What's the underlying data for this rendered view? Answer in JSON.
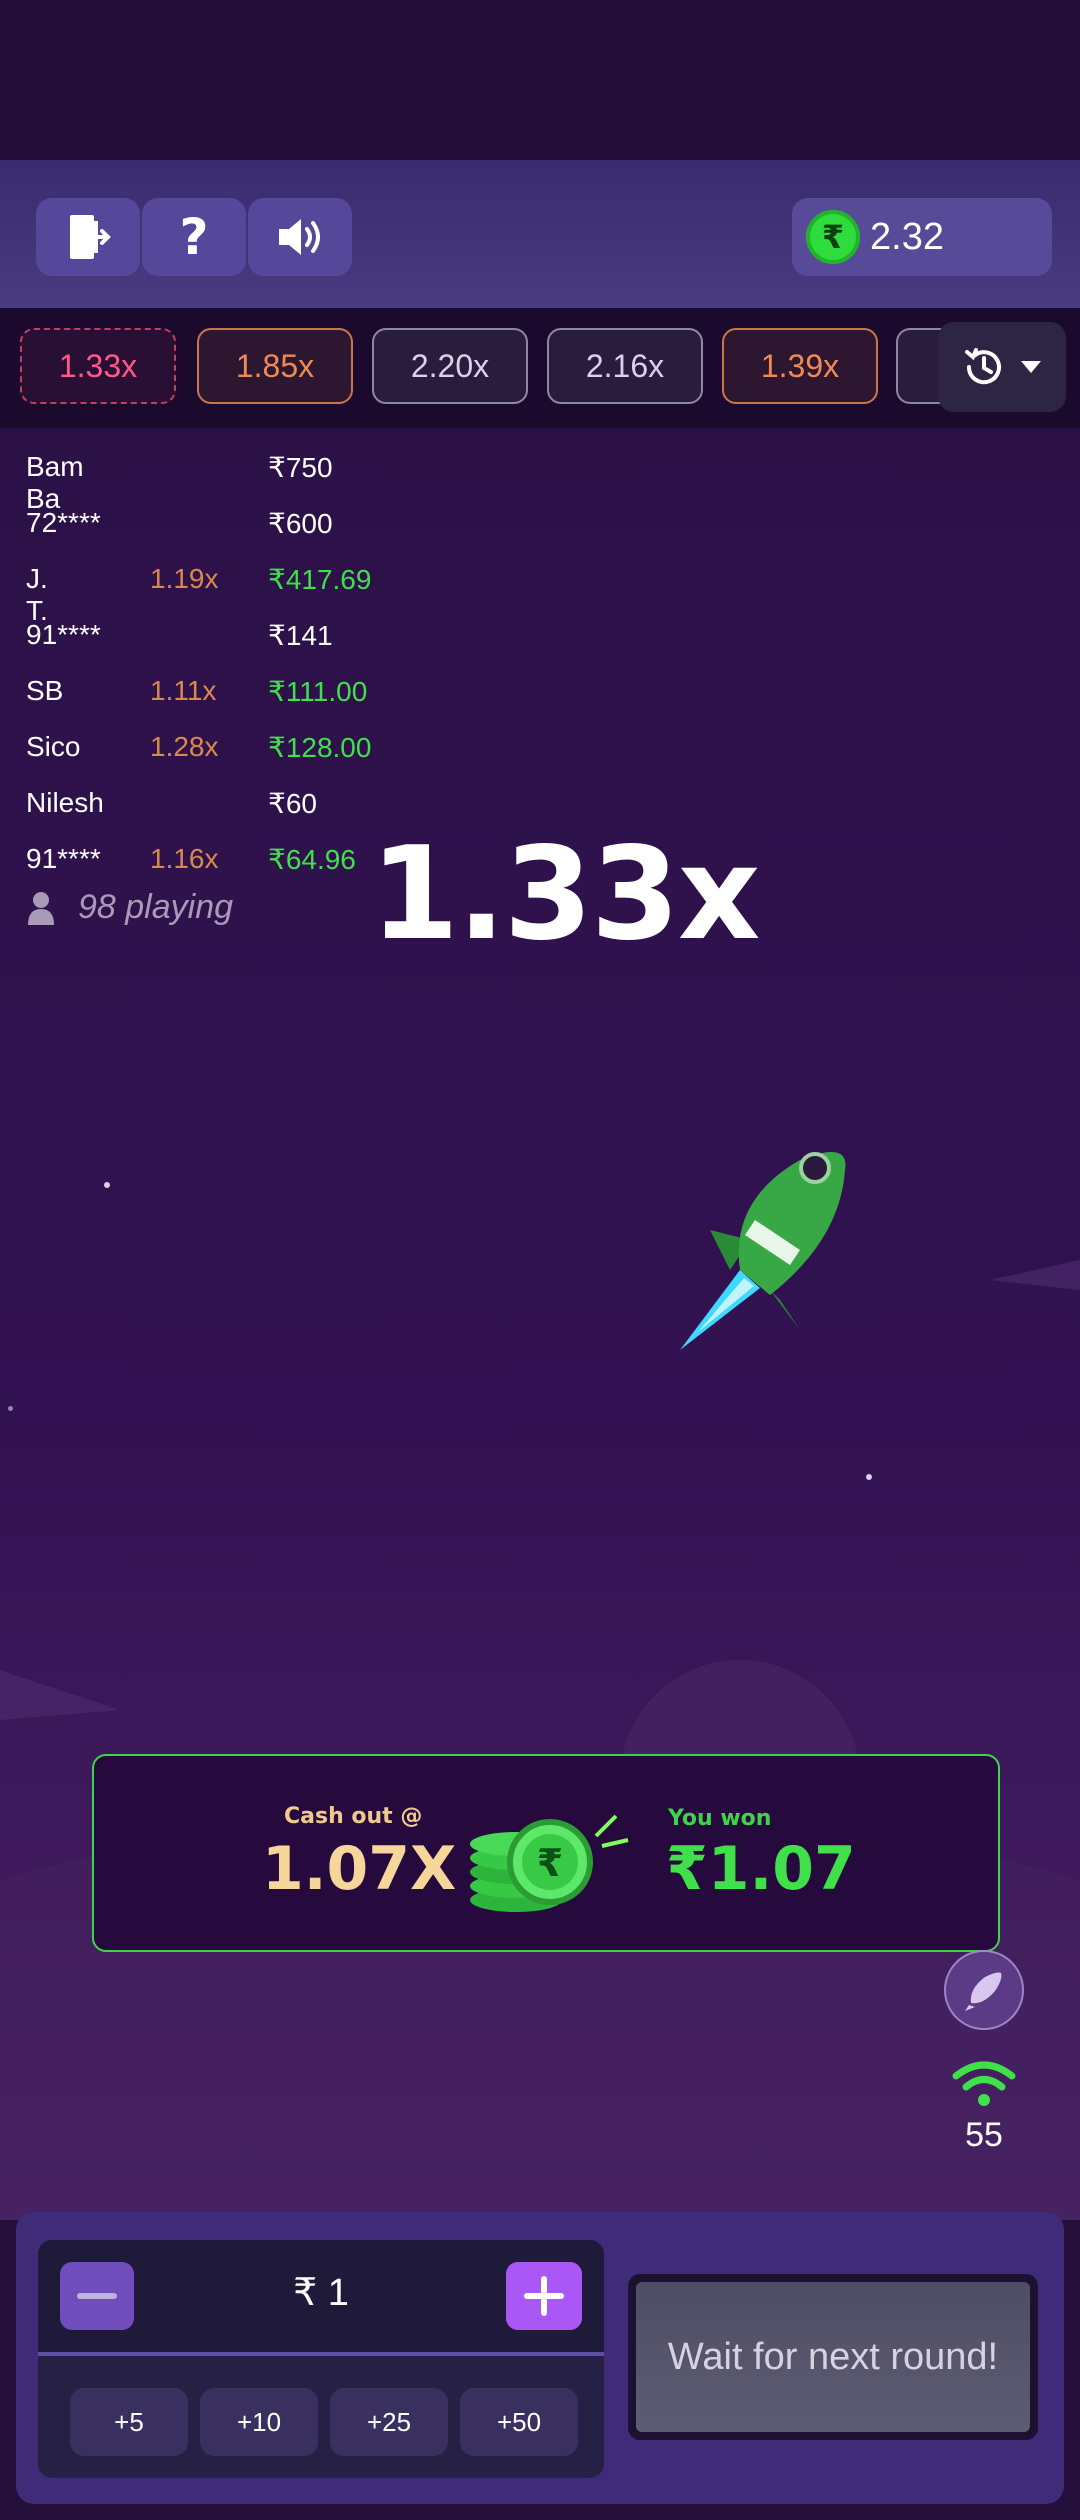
{
  "toolbar": {
    "exit_icon": "exit-door-icon",
    "help_icon": "question-icon",
    "sound_icon": "speaker-icon",
    "balance_currency": "₹",
    "balance": "2.32"
  },
  "history": {
    "items": [
      "1.33x",
      "1.85x",
      "2.20x",
      "2.16x",
      "1.39x"
    ],
    "item_colors": [
      "pink",
      "orange",
      "gray",
      "gray",
      "orange"
    ],
    "toggle_icon": "history-clock-icon"
  },
  "players": [
    {
      "name": "Bam Ba",
      "mult": "",
      "amount": "₹750",
      "won": false
    },
    {
      "name": "72****",
      "mult": "",
      "amount": "₹600",
      "won": false
    },
    {
      "name": "J. T.",
      "mult": "1.19x",
      "amount": "₹417.69",
      "won": true
    },
    {
      "name": "91****",
      "mult": "",
      "amount": "₹141",
      "won": false
    },
    {
      "name": "SB",
      "mult": "1.11x",
      "amount": "₹111.00",
      "won": true
    },
    {
      "name": "Sico",
      "mult": "1.28x",
      "amount": "₹128.00",
      "won": true
    },
    {
      "name": "Nilesh",
      "mult": "",
      "amount": "₹60",
      "won": false
    },
    {
      "name": "91****",
      "mult": "1.16x",
      "amount": "₹64.96",
      "won": true
    }
  ],
  "playing_count": "98 playing",
  "current_multiplier": "1.33x",
  "cashout": {
    "label": "Cash out @",
    "value": "1.07X",
    "won_label": "You won",
    "won_value": "₹1.07"
  },
  "ping": "55",
  "bet": {
    "stake": "₹ 1",
    "quick_adds": [
      "+5",
      "+10",
      "+25",
      "+50"
    ],
    "action_label": "Wait for next round!"
  },
  "colors": {
    "accent_green": "#3fe04a",
    "multiplier_orange": "#d98a4a",
    "history_pink": "#ff5a86",
    "plus_button": "#a957f5"
  }
}
